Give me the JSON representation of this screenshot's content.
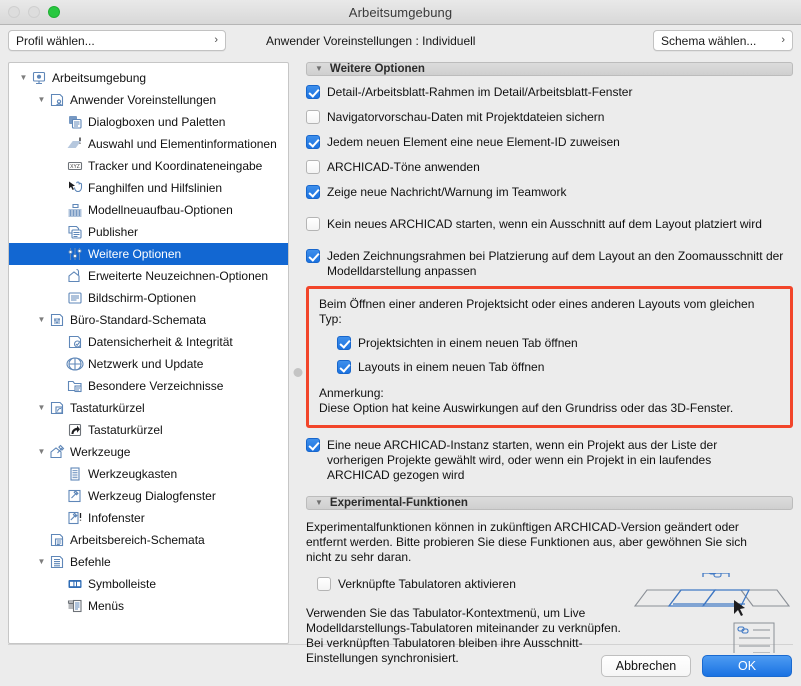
{
  "window": {
    "title": "Arbeitsumgebung",
    "traffic_lights": [
      "close-button",
      "minimize-button",
      "zoom-button"
    ]
  },
  "toolbar": {
    "profile_button": "Profil wählen...",
    "center_label": "Anwender Voreinstellungen : Individuell",
    "schema_button": "Schema wählen...",
    "chevron": "›"
  },
  "sidebar": {
    "items": [
      {
        "label": "Arbeitsumgebung",
        "depth": 0,
        "twisty": "open",
        "icon": "monitor-gear-icon",
        "selected": false
      },
      {
        "label": "Anwender Voreinstellungen",
        "depth": 1,
        "twisty": "open",
        "icon": "user-prefs-icon",
        "selected": false
      },
      {
        "label": "Dialogboxen und Paletten",
        "depth": 2,
        "twisty": "none",
        "icon": "dialogs-palettes-icon",
        "selected": false
      },
      {
        "label": "Auswahl und Elementinformationen",
        "depth": 2,
        "twisty": "none",
        "icon": "selection-info-icon",
        "selected": false
      },
      {
        "label": "Tracker und Koordinateneingabe",
        "depth": 2,
        "twisty": "none",
        "icon": "xyz-tracker-icon",
        "selected": false
      },
      {
        "label": "Fanghilfen und Hilfslinien",
        "depth": 2,
        "twisty": "none",
        "icon": "snap-guides-icon",
        "selected": false
      },
      {
        "label": "Modellneuaufbau-Optionen",
        "depth": 2,
        "twisty": "none",
        "icon": "model-rebuild-icon",
        "selected": false
      },
      {
        "label": "Publisher",
        "depth": 2,
        "twisty": "none",
        "icon": "publisher-icon",
        "selected": false
      },
      {
        "label": "Weitere Optionen",
        "depth": 2,
        "twisty": "none",
        "icon": "more-options-icon",
        "selected": true
      },
      {
        "label": "Erweiterte Neuzeichnen-Optionen",
        "depth": 2,
        "twisty": "none",
        "icon": "advanced-redraw-icon",
        "selected": false
      },
      {
        "label": "Bildschirm-Optionen",
        "depth": 2,
        "twisty": "none",
        "icon": "screen-options-icon",
        "selected": false
      },
      {
        "label": "Büro-Standard-Schemata",
        "depth": 1,
        "twisty": "open",
        "icon": "office-standards-icon",
        "selected": false
      },
      {
        "label": "Datensicherheit & Integrität",
        "depth": 2,
        "twisty": "none",
        "icon": "data-safety-icon",
        "selected": false
      },
      {
        "label": "Netzwerk und Update",
        "depth": 2,
        "twisty": "none",
        "icon": "globe-icon",
        "selected": false
      },
      {
        "label": "Besondere Verzeichnisse",
        "depth": 2,
        "twisty": "none",
        "icon": "special-folders-icon",
        "selected": false
      },
      {
        "label": "Tastaturkürzel",
        "depth": 1,
        "twisty": "open",
        "icon": "shortcut-schemes-icon",
        "selected": false
      },
      {
        "label": "Tastaturkürzel",
        "depth": 2,
        "twisty": "none",
        "icon": "shortcut-arrow-icon",
        "selected": false
      },
      {
        "label": "Werkzeuge",
        "depth": 1,
        "twisty": "open",
        "icon": "tools-icon",
        "selected": false
      },
      {
        "label": "Werkzeugkasten",
        "depth": 2,
        "twisty": "none",
        "icon": "toolbox-icon",
        "selected": false
      },
      {
        "label": "Werkzeug Dialogfenster",
        "depth": 2,
        "twisty": "none",
        "icon": "tool-dialog-icon",
        "selected": false
      },
      {
        "label": "Infofenster",
        "depth": 2,
        "twisty": "none",
        "icon": "info-box-icon",
        "selected": false
      },
      {
        "label": "Arbeitsbereich-Schemata",
        "depth": 1,
        "twisty": "none",
        "icon": "workspace-schemes-icon",
        "selected": false
      },
      {
        "label": "Befehle",
        "depth": 1,
        "twisty": "open",
        "icon": "commands-icon",
        "selected": false
      },
      {
        "label": "Symbolleiste",
        "depth": 2,
        "twisty": "none",
        "icon": "toolbar-icon",
        "selected": false
      },
      {
        "label": "Menüs",
        "depth": 2,
        "twisty": "none",
        "icon": "menus-icon",
        "selected": false
      }
    ]
  },
  "main": {
    "section_more_options": {
      "title": "Weitere Optionen",
      "options": [
        {
          "label": "Detail-/Arbeitsblatt-Rahmen im Detail/Arbeitsblatt-Fenster",
          "checked": true
        },
        {
          "label": "Navigatorvorschau-Daten mit Projektdateien sichern",
          "checked": false
        },
        {
          "label": "Jedem neuen Element eine neue Element-ID zuweisen",
          "checked": true
        },
        {
          "label": "ARCHICAD-Töne anwenden",
          "checked": false
        },
        {
          "label": "Zeige neue Nachricht/Warnung im Teamwork",
          "checked": true
        },
        {
          "label": "Kein neues ARCHICAD starten, wenn ein Ausschnitt auf dem Layout platziert wird",
          "checked": false
        },
        {
          "label": "Jeden Zeichnungsrahmen bei Platzierung auf dem Layout an den Zoomausschnitt der Modelldarstellung anpassen",
          "checked": true
        }
      ],
      "highlight_box": {
        "intro": "Beim Öffnen einer anderen Projektsicht oder eines anderen Layouts vom gleichen Typ:",
        "options": [
          {
            "label": "Projektsichten in einem neuen Tab öffnen",
            "checked": true
          },
          {
            "label": "Layouts in einem neuen Tab öffnen",
            "checked": true
          }
        ],
        "note_title": "Anmerkung:",
        "note_text": "Diese Option hat keine Auswirkungen auf den Grundriss oder das 3D-Fenster.",
        "border_color": "#f2452a"
      },
      "trailing_option": {
        "label": "Eine neue ARCHICAD-Instanz starten, wenn ein Projekt aus der Liste der vorherigen Projekte gewählt wird, oder wenn ein Projekt in ein laufendes ARCHICAD gezogen wird",
        "checked": true
      }
    },
    "section_experimental": {
      "title": "Experimental-Funktionen",
      "description": "Experimentalfunktionen können in zukünftigen ARCHICAD-Version geändert oder entfernt werden. Bitte probieren Sie diese Funktionen aus, aber gewöhnen Sie sich nicht zu sehr daran.",
      "option": {
        "label": "Verknüpfte Tabulatoren aktivieren",
        "checked": false
      },
      "hint": "Verwenden Sie das Tabulator-Kontextmenü, um Live Modelldarstellungs-Tabulatoren miteinander zu verknüpfen. Bei verknüpften Tabulatoren bleiben ihre Ausschnitt-Einstellungen synchronisiert."
    }
  },
  "footer": {
    "cancel_label": "Abbrechen",
    "ok_label": "OK"
  },
  "colors": {
    "selection_blue": "#1267d2",
    "checkbox_blue": "#1b72e0",
    "highlight_red": "#f2452a",
    "primary_button": "#1a72e2",
    "icon_blue": "#5f87b8"
  }
}
